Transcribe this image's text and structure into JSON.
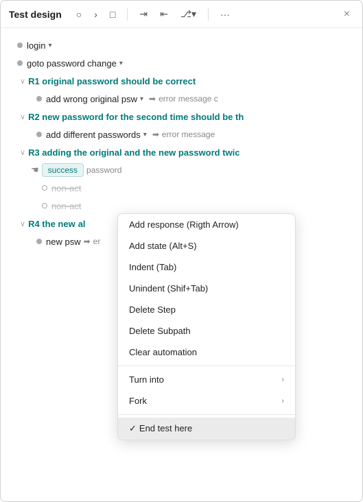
{
  "window": {
    "title": "Test design",
    "close_label": "×"
  },
  "toolbar": {
    "icons": [
      {
        "name": "circle-icon",
        "symbol": "○"
      },
      {
        "name": "chevron-right-icon",
        "symbol": ">"
      },
      {
        "name": "square-icon",
        "symbol": "□"
      },
      {
        "name": "pipe-right-icon",
        "symbol": "⇥"
      },
      {
        "name": "pipe-left-icon",
        "symbol": "⇤"
      },
      {
        "name": "branch-icon",
        "symbol": "⎇"
      },
      {
        "name": "more-icon",
        "symbol": "···"
      }
    ]
  },
  "tree": {
    "rows": [
      {
        "id": "login",
        "label": "login",
        "type": "dot",
        "indent": 0,
        "hasChevron": true
      },
      {
        "id": "goto-pw",
        "label": "goto password change",
        "type": "dot",
        "indent": 0,
        "hasChevron": true
      },
      {
        "id": "r1",
        "label": "R1 original password should be correct",
        "type": "group",
        "indent": 1
      },
      {
        "id": "add-wrong",
        "label": "add wrong original psw",
        "type": "dot",
        "indent": 2,
        "hasChevron": true,
        "hasArrow": true,
        "extra": "error message c"
      },
      {
        "id": "r2",
        "label": "R2 new password for the second time should be th",
        "type": "group",
        "indent": 1
      },
      {
        "id": "add-diff",
        "label": "add different passwords",
        "type": "dot",
        "indent": 2,
        "hasChevron": true,
        "hasArrow": true,
        "extra": "error message"
      },
      {
        "id": "r3",
        "label": "R3 adding the original and the new password twic",
        "type": "group",
        "indent": 1
      },
      {
        "id": "success",
        "label": "success",
        "type": "hand-dot",
        "indent": 2,
        "extra": "password",
        "extraRight": true
      },
      {
        "id": "non-act1",
        "label": "non-act",
        "type": "dot-outline",
        "indent": 3,
        "strikethrough": true
      },
      {
        "id": "non-act2",
        "label": "non-act",
        "type": "dot-outline",
        "indent": 3,
        "strikethrough": true
      },
      {
        "id": "r4",
        "label": "R4 the new",
        "type": "group",
        "indent": 1,
        "extra": "al"
      },
      {
        "id": "new-psw",
        "label": "new psw",
        "type": "dot",
        "indent": 2,
        "hasArrow": true,
        "extra": "er"
      }
    ]
  },
  "context_menu": {
    "items": [
      {
        "id": "add-response",
        "label": "Add response (Rigth Arrow)",
        "hasArrow": false
      },
      {
        "id": "add-state",
        "label": "Add state (Alt+S)",
        "hasArrow": false
      },
      {
        "id": "indent",
        "label": "Indent (Tab)",
        "hasArrow": false
      },
      {
        "id": "unindent",
        "label": "Unindent (Shif+Tab)",
        "hasArrow": false
      },
      {
        "id": "delete-step",
        "label": "Delete Step",
        "hasArrow": false
      },
      {
        "id": "delete-subpath",
        "label": "Delete Subpath",
        "hasArrow": false
      },
      {
        "id": "clear-automation",
        "label": "Clear automation",
        "hasArrow": false
      },
      {
        "id": "sep1",
        "type": "separator"
      },
      {
        "id": "turn-into",
        "label": "Turn into",
        "hasArrow": true
      },
      {
        "id": "fork",
        "label": "Fork",
        "hasArrow": true
      },
      {
        "id": "sep2",
        "type": "separator"
      },
      {
        "id": "end-test",
        "label": "End test here",
        "hasCheck": true,
        "active": true
      }
    ]
  }
}
